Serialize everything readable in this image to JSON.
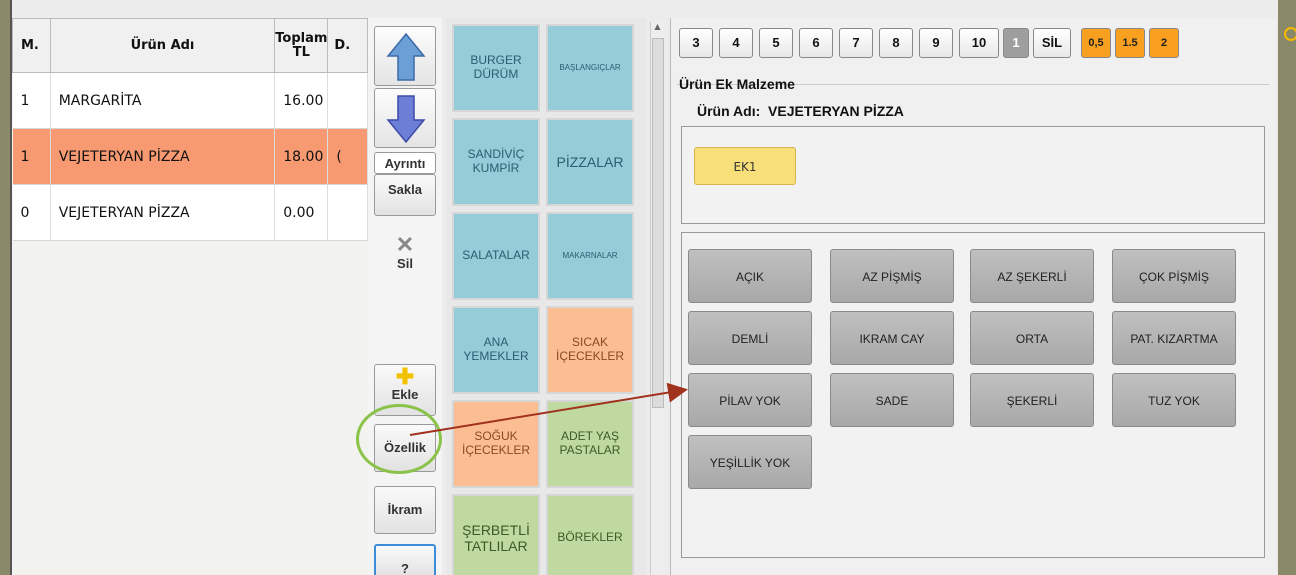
{
  "order_table": {
    "headers": {
      "m": "M.",
      "name": "Ürün Adı",
      "total_top": "Toplam",
      "total_bottom": "TL",
      "d": "D."
    },
    "rows": [
      {
        "m": "1",
        "name": "MARGARİTA",
        "total": "16.00",
        "d": ""
      },
      {
        "m": "1",
        "name": "VEJETERYAN PİZZA",
        "total": "18.00",
        "d": "("
      },
      {
        "m": "0",
        "name": "VEJETERYAN PİZZA",
        "total": "0.00",
        "d": ""
      }
    ]
  },
  "side": {
    "detail": "Ayrıntı",
    "hide": "Sakla",
    "delete": "Sil",
    "add": "Ekle",
    "feature": "Özellik",
    "treat": "İkram",
    "help": "?"
  },
  "categories": [
    {
      "label": "BURGER DÜRÜM",
      "color": "blue"
    },
    {
      "label": "BAŞLANGIÇLAR",
      "color": "blue"
    },
    {
      "label": "SANDİVİÇ KUMPİR",
      "color": "blue"
    },
    {
      "label": "PİZZALAR",
      "color": "blue"
    },
    {
      "label": "SALATALAR",
      "color": "blue"
    },
    {
      "label": "MAKARNALAR",
      "color": "blue"
    },
    {
      "label": "ANA YEMEKLER",
      "color": "blue"
    },
    {
      "label": "SICAK İÇECEKLER",
      "color": "orange"
    },
    {
      "label": "SOĞUK İÇECEKLER",
      "color": "orange"
    },
    {
      "label": "ADET YAŞ PASTALAR",
      "color": "green"
    },
    {
      "label": "ŞERBETLİ TATLILAR",
      "color": "green"
    },
    {
      "label": "BÖREKLER",
      "color": "green"
    }
  ],
  "keypad": [
    "3",
    "4",
    "5",
    "6",
    "7",
    "8",
    "9",
    "10",
    "1",
    "SİL",
    "0,5",
    "1.5",
    "2"
  ],
  "extras_panel": {
    "group_title": "Ürün Ek Malzeme",
    "product_label": "Ürün Adı:",
    "product_name": "VEJETERYAN PİZZA",
    "ek_button": "EK1",
    "options": [
      "AÇIK",
      "AZ PİŞMİŞ",
      "AZ ŞEKERLİ",
      "ÇOK PİŞMİŞ",
      "DEMLİ",
      "IKRAM CAY",
      "ORTA",
      "PAT. KIZARTMA",
      "PİLAV YOK",
      "SADE",
      "ŞEKERLİ",
      "TUZ YOK",
      "YEŞİLLİK YOK"
    ]
  },
  "colors": {
    "selected_row": "#f79a72",
    "annotation": "#8bc34a",
    "arrow": "#a0321e"
  }
}
